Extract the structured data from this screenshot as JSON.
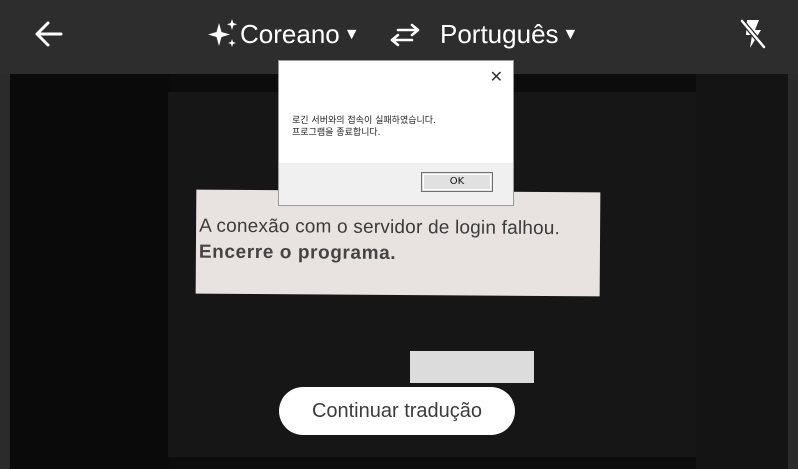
{
  "topbar": {
    "source_language": "Coreano",
    "target_language": "Português",
    "icons": {
      "back": "arrow-back-icon",
      "sparkle": "auto-detect-sparkle-icon",
      "swap": "swap-languages-icon",
      "flash": "flash-off-icon",
      "caret": "dropdown-caret-icon"
    },
    "caret_glyph": "▼"
  },
  "dialog": {
    "close_glyph": "✕",
    "message_line1": "로긴 서버와의 접속이 실패하였습니다.",
    "message_line2": "프로그램을 종료합니다.",
    "ok_label": "OK"
  },
  "translation_overlay": {
    "line1": "A conexão com o servidor de login falhou.",
    "line2": "Encerre o programa."
  },
  "continue_button": {
    "label": "Continuar tradução"
  },
  "colors": {
    "topbar_bg": "#2d2d2d",
    "overlay_bg": "#e8e3e0",
    "button_bg": "#ffffff"
  }
}
